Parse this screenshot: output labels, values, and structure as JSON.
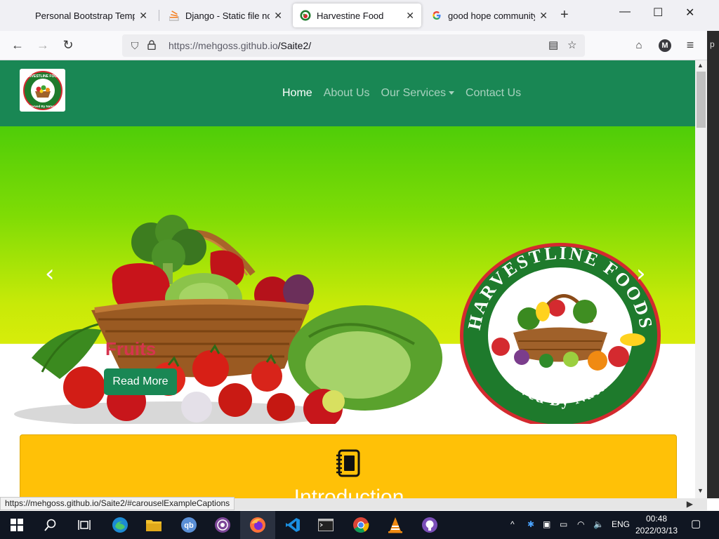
{
  "browser": {
    "tabs": [
      {
        "title": "Personal Bootstrap Template",
        "icon": "page-icon"
      },
      {
        "title": "Django - Static file not fo",
        "icon": "stackoverflow-icon"
      },
      {
        "title": "Harvestine Food",
        "icon": "harvestine-favicon",
        "active": true
      },
      {
        "title": "good hope community c",
        "icon": "google-icon"
      }
    ],
    "url_host": "https://mehgoss.github.io",
    "url_path": "/Saite2/",
    "account_initial": "M",
    "side_letter": "p"
  },
  "site": {
    "nav": {
      "items": [
        {
          "label": "Home",
          "active": true
        },
        {
          "label": "About Us"
        },
        {
          "label": "Our Services",
          "dropdown": true
        },
        {
          "label": "Contact Us"
        }
      ]
    },
    "logo": {
      "top_text": "HARVESTLINE FOODS",
      "bottom_text": "Served By Nature"
    },
    "carousel": {
      "caption": "Fruits",
      "button": "Read More",
      "badge_top": "HARVESTLINE FOODS",
      "badge_bottom": "Served By Nature",
      "active_slide": 2
    },
    "intro": {
      "title": "Introduction"
    }
  },
  "status_url": "https://mehgoss.github.io/Saite2/#carouselExampleCaptions",
  "taskbar": {
    "language": "ENG",
    "time": "00:48",
    "date": "2022/03/13"
  },
  "colors": {
    "brand_green": "#198754",
    "intro_yellow": "#ffc107",
    "caption_red": "#d6344e",
    "badge_red": "#d42a2f",
    "badge_green": "#1e7a2c"
  }
}
